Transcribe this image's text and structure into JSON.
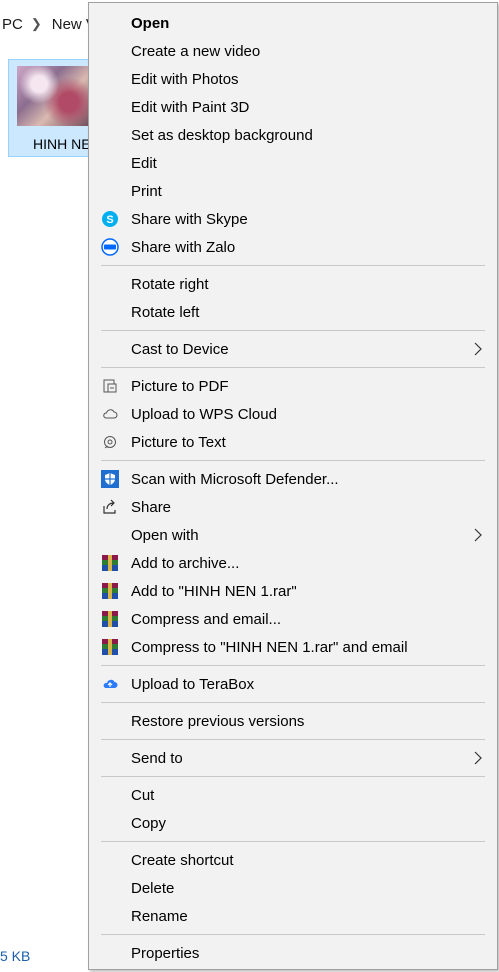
{
  "explorer": {
    "breadcrumb": [
      "PC",
      "New V"
    ],
    "file_label": "HINH NEN",
    "size_text": "5 KB"
  },
  "menu": {
    "open": "Open",
    "create_video": "Create a new video",
    "edit_photos": "Edit with Photos",
    "edit_paint3d": "Edit with Paint 3D",
    "set_background": "Set as desktop background",
    "edit": "Edit",
    "print": "Print",
    "share_skype": "Share with Skype",
    "share_zalo": "Share with Zalo",
    "rotate_right": "Rotate right",
    "rotate_left": "Rotate left",
    "cast": "Cast to Device",
    "picture_pdf": "Picture to PDF",
    "upload_wps": "Upload to WPS Cloud",
    "picture_text": "Picture to Text",
    "scan_defender": "Scan with Microsoft Defender...",
    "share": "Share",
    "open_with": "Open with",
    "add_archive": "Add to archive...",
    "add_rar": "Add to \"HINH NEN 1.rar\"",
    "compress_email": "Compress and email...",
    "compress_rar_email": "Compress to \"HINH NEN 1.rar\" and email",
    "upload_terabox": "Upload to TeraBox",
    "restore": "Restore previous versions",
    "send_to": "Send to",
    "cut": "Cut",
    "copy": "Copy",
    "create_shortcut": "Create shortcut",
    "delete": "Delete",
    "rename": "Rename",
    "properties": "Properties"
  },
  "colors": {
    "menu_bg": "#f2f2f2",
    "selection_bg": "#cce8ff",
    "skype": "#00aff0",
    "zalo": "#0068ff",
    "defender": "#1f6fd1",
    "winrar": "#8b1a4a",
    "terabox": "#2b7bff"
  },
  "icons": {
    "skype": "skype-icon",
    "zalo": "zalo-icon",
    "pdf": "picture-to-pdf-icon",
    "cloud": "cloud-icon",
    "ocr": "picture-to-text-icon",
    "defender": "shield-icon",
    "share": "share-icon",
    "winrar": "winrar-icon",
    "terabox": "terabox-icon",
    "submenu": "chevron-right-icon"
  }
}
